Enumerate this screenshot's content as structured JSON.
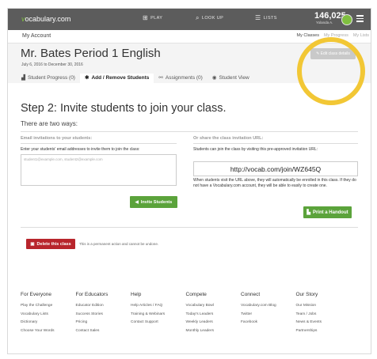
{
  "topbar": {
    "logo_prefix": "v",
    "logo_rest": "ocabulary.com",
    "nav": [
      {
        "icon": "play-grid-icon",
        "glyph": "⊞",
        "label": "PLAY"
      },
      {
        "icon": "search-icon",
        "glyph": "⌕",
        "label": "LOOK UP"
      },
      {
        "icon": "lists-icon",
        "glyph": "☰",
        "label": "LISTS"
      }
    ],
    "points": "146,025",
    "user": "Yolanda A."
  },
  "account": {
    "label": "My Account",
    "links": [
      "My Classes",
      "My Progress",
      "My Lists"
    ]
  },
  "class": {
    "title": "Mr. Bates Period 1 English",
    "dates": "July 6, 2016 to December 30, 2016",
    "edit_label": "Edit class details"
  },
  "tabs": [
    {
      "icon": "progress-icon",
      "glyph": "▟",
      "label": "Student Progress (0)"
    },
    {
      "icon": "gear-icon",
      "glyph": "✱",
      "label": "Add / Remove Students"
    },
    {
      "icon": "link-icon",
      "glyph": "⚯",
      "label": "Assignments (0)"
    },
    {
      "icon": "eye-icon",
      "glyph": "◉",
      "label": "Student View"
    }
  ],
  "main": {
    "step_title": "Step 2: Invite students to join your class.",
    "two_ways": "There are two ways:",
    "email_section": {
      "title": "Email invitations to your students:",
      "instructions": "Enter your students' email addresses to invite them to join the class:",
      "placeholder": "student1@example.com, student2@example.com",
      "button_label": "Invite Students"
    },
    "url_section": {
      "title": "Or share the class invitation URL:",
      "instructions": "Students can join the class by visiting this pre-approved invitation URL:",
      "url": "http://vocab.com/join/WZ645Q",
      "note": "When students visit the URL above, they will automatically be enrolled in this class. If they do not have a Vocabulary.com account, they will be able to easily to create one.",
      "button_label": "Print a Handout"
    },
    "delete_label": "Delete this class",
    "delete_warning": "This is a permanent action and cannot be undone."
  },
  "footer": [
    {
      "heading": "For Everyone",
      "links": [
        "Play the Challenge",
        "Vocabulary Lists",
        "Dictionary",
        "Choose Your Words"
      ]
    },
    {
      "heading": "For Educators",
      "links": [
        "Educator Edition",
        "Success Stories",
        "Pricing",
        "Contact Sales"
      ]
    },
    {
      "heading": "Help",
      "links": [
        "Help Articles / FAQ",
        "Training & Webinars",
        "Contact Support"
      ]
    },
    {
      "heading": "Compete",
      "links": [
        "Vocabulary Bowl",
        "Today's Leaders",
        "Weekly Leaders",
        "Monthly Leaders"
      ]
    },
    {
      "heading": "Connect",
      "links": [
        "Vocabulary.com Blog",
        "Twitter",
        "Facebook"
      ]
    },
    {
      "heading": "Our Story",
      "links": [
        "Our Mission",
        "Team / Jobs",
        "News & Events",
        "Partnerships"
      ]
    }
  ],
  "colors": {
    "green": "#5ba33b",
    "red": "#b8252c",
    "topbar": "#5c5c5c",
    "highlight": "#f2c735"
  }
}
